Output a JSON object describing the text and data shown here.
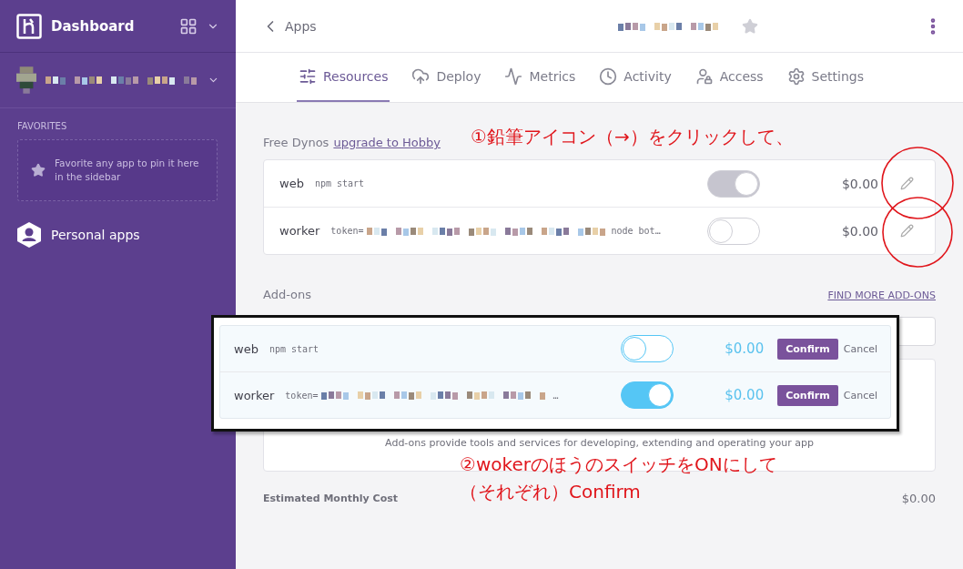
{
  "sidebar": {
    "title": "Dashboard",
    "favorites_heading": "FAVORITES",
    "favorites_hint": "Favorite any app to pin it here in the sidebar",
    "items": [
      {
        "label": "Personal apps",
        "selected": false
      }
    ]
  },
  "header": {
    "back": "Apps"
  },
  "tabs": [
    {
      "label": "Resources",
      "selected": true
    },
    {
      "label": "Deploy",
      "selected": false
    },
    {
      "label": "Metrics",
      "selected": false
    },
    {
      "label": "Activity",
      "selected": false
    },
    {
      "label": "Access",
      "selected": false
    },
    {
      "label": "Settings",
      "selected": false
    }
  ],
  "dynos": {
    "heading": "Free Dynos",
    "upgrade_link": "upgrade to Hobby",
    "rows": [
      {
        "name": "web",
        "command": "npm start",
        "redacted": false,
        "on": true,
        "price": "$0.00"
      },
      {
        "name": "worker",
        "command": "token=",
        "redacted": true,
        "command_tail": "node bot…",
        "on": false,
        "price": "$0.00"
      }
    ]
  },
  "edit_overlay": {
    "rows": [
      {
        "name": "web",
        "command": "npm start",
        "redacted": false,
        "on": false,
        "price": "$0.00",
        "confirm": "Confirm",
        "cancel": "Cancel"
      },
      {
        "name": "worker",
        "command": "token=",
        "redacted": true,
        "command_tail": "…",
        "on": true,
        "price": "$0.00",
        "confirm": "Confirm",
        "cancel": "Cancel"
      }
    ]
  },
  "addons": {
    "heading": "Add-ons",
    "link": "FIND MORE ADD-ONS",
    "description": "Add-ons provide tools and services for developing, extending and operating your app"
  },
  "cost": {
    "label": "Estimated Monthly Cost",
    "value": "$0.00"
  },
  "annotations": [
    {
      "lines": [
        "①鉛筆アイコン（→）をクリックして、"
      ]
    },
    {
      "lines": [
        "②wokerのほうのスイッチをONにして",
        "（それぞれ）Confirm"
      ]
    }
  ]
}
